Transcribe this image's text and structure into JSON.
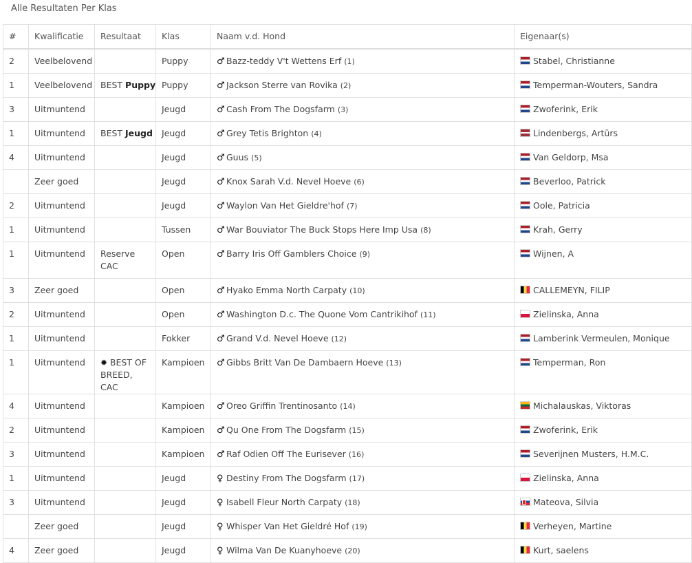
{
  "page": {
    "title": "Alle Resultaten Per Klas"
  },
  "columns": [
    "#",
    "Kwalificatie",
    "Resultaat",
    "Klas",
    "Naam v.d. Hond",
    "Eigenaar(s)"
  ],
  "rows": [
    {
      "rank": "2",
      "qual": "Veelbelovend",
      "res_prefix": "",
      "res_bold": "",
      "res_lines": [],
      "klas": "Puppy",
      "sex": "♂",
      "dog": "Bazz-teddy V't Wettens Erf",
      "catno": "(1)",
      "flag": "nl",
      "owner": "Stabel, Christianne"
    },
    {
      "rank": "1",
      "qual": "Veelbelovend",
      "res_prefix": "BEST",
      "res_bold": "Puppy",
      "res_lines": [],
      "klas": "Puppy",
      "sex": "♂",
      "dog": "Jackson Sterre van Rovika",
      "catno": "(2)",
      "flag": "nl",
      "owner": "Temperman-Wouters, Sandra"
    },
    {
      "rank": "3",
      "qual": "Uitmuntend",
      "res_prefix": "",
      "res_bold": "",
      "res_lines": [],
      "klas": "Jeugd",
      "sex": "♂",
      "dog": "Cash From The Dogsfarm",
      "catno": "(3)",
      "flag": "nl",
      "owner": "Zwoferink, Erik"
    },
    {
      "rank": "1",
      "qual": "Uitmuntend",
      "res_prefix": "BEST",
      "res_bold": "Jeugd",
      "res_lines": [],
      "klas": "Jeugd",
      "sex": "♂",
      "dog": "Grey Tetis Brighton",
      "catno": "(4)",
      "flag": "lv",
      "owner": "Lindenbergs, Artūrs"
    },
    {
      "rank": "4",
      "qual": "Uitmuntend",
      "res_prefix": "",
      "res_bold": "",
      "res_lines": [],
      "klas": "Jeugd",
      "sex": "♂",
      "dog": "Guus",
      "catno": "(5)",
      "flag": "nl",
      "owner": "Van Geldorp, Msa"
    },
    {
      "rank": "",
      "qual": "Zeer goed",
      "res_prefix": "",
      "res_bold": "",
      "res_lines": [],
      "klas": "Jeugd",
      "sex": "♂",
      "dog": "Knox Sarah V.d. Nevel Hoeve",
      "catno": "(6)",
      "flag": "nl",
      "owner": "Beverloo, Patrick"
    },
    {
      "rank": "2",
      "qual": "Uitmuntend",
      "res_prefix": "",
      "res_bold": "",
      "res_lines": [],
      "klas": "Jeugd",
      "sex": "♂",
      "dog": "Waylon Van Het Gieldre'hof",
      "catno": "(7)",
      "flag": "nl",
      "owner": "Oole, Patricia"
    },
    {
      "rank": "1",
      "qual": "Uitmuntend",
      "res_prefix": "",
      "res_bold": "",
      "res_lines": [],
      "klas": "Tussen",
      "sex": "♂",
      "dog": "War Bouviator The Buck Stops Here Imp Usa",
      "catno": "(8)",
      "flag": "nl",
      "owner": "Krah, Gerry"
    },
    {
      "rank": "1",
      "qual": "Uitmuntend",
      "res_prefix": "",
      "res_bold": "",
      "res_lines": [
        "Reserve",
        "CAC"
      ],
      "klas": "Open",
      "sex": "♂",
      "dog": "Barry Iris Off Gamblers Choice",
      "catno": "(9)",
      "flag": "nl",
      "owner": "Wijnen, A"
    },
    {
      "rank": "3",
      "qual": "Zeer goed",
      "res_prefix": "",
      "res_bold": "",
      "res_lines": [],
      "klas": "Open",
      "sex": "♂",
      "dog": "Hyako Emma North Carpaty",
      "catno": "(10)",
      "flag": "be",
      "owner": "CALLEMEYN, FILIP"
    },
    {
      "rank": "2",
      "qual": "Uitmuntend",
      "res_prefix": "",
      "res_bold": "",
      "res_lines": [],
      "klas": "Open",
      "sex": "♂",
      "dog": "Washington D.c. The Quone Vom Cantrikihof",
      "catno": "(11)",
      "flag": "pl",
      "owner": "Zielinska, Anna"
    },
    {
      "rank": "1",
      "qual": "Uitmuntend",
      "res_prefix": "",
      "res_bold": "",
      "res_lines": [],
      "klas": "Fokker",
      "sex": "♂",
      "dog": "Grand V.d. Nevel Hoeve",
      "catno": "(12)",
      "flag": "nl",
      "owner": "Lamberink Vermeulen, Monique"
    },
    {
      "rank": "1",
      "qual": "Uitmuntend",
      "res_prefix": "",
      "res_bold": "",
      "res_lines": [
        "BEST OF",
        "BREED, CAC"
      ],
      "res_star": true,
      "klas": "Kampioen",
      "sex": "♂",
      "dog": "Gibbs Britt Van De Dambaern Hoeve",
      "catno": "(13)",
      "flag": "nl",
      "owner": "Temperman, Ron"
    },
    {
      "rank": "4",
      "qual": "Uitmuntend",
      "res_prefix": "",
      "res_bold": "",
      "res_lines": [],
      "klas": "Kampioen",
      "sex": "♂",
      "dog": "Oreo Griffin Trentinosanto",
      "catno": "(14)",
      "flag": "lt",
      "owner": "Michalauskas, Viktoras"
    },
    {
      "rank": "2",
      "qual": "Uitmuntend",
      "res_prefix": "",
      "res_bold": "",
      "res_lines": [],
      "klas": "Kampioen",
      "sex": "♂",
      "dog": "Qu One From The Dogsfarm",
      "catno": "(15)",
      "flag": "nl",
      "owner": "Zwoferink, Erik"
    },
    {
      "rank": "3",
      "qual": "Uitmuntend",
      "res_prefix": "",
      "res_bold": "",
      "res_lines": [],
      "klas": "Kampioen",
      "sex": "♂",
      "dog": "Raf Odien Off The Eurisever",
      "catno": "(16)",
      "flag": "nl",
      "owner": "Severijnen Musters, H.M.C."
    },
    {
      "rank": "1",
      "qual": "Uitmuntend",
      "res_prefix": "",
      "res_bold": "",
      "res_lines": [],
      "klas": "Jeugd",
      "sex": "♀",
      "dog": "Destiny From The Dogsfarm",
      "catno": "(17)",
      "flag": "pl",
      "owner": "Zielinska, Anna"
    },
    {
      "rank": "3",
      "qual": "Uitmuntend",
      "res_prefix": "",
      "res_bold": "",
      "res_lines": [],
      "klas": "Jeugd",
      "sex": "♀",
      "dog": "Isabell Fleur North Carpaty",
      "catno": "(18)",
      "flag": "sk",
      "owner": "Mateova, Silvia"
    },
    {
      "rank": "",
      "qual": "Zeer goed",
      "res_prefix": "",
      "res_bold": "",
      "res_lines": [],
      "klas": "Jeugd",
      "sex": "♀",
      "dog": "Whisper Van Het Gieldré Hof",
      "catno": "(19)",
      "flag": "be",
      "owner": "Verheyen, Martine"
    },
    {
      "rank": "4",
      "qual": "Zeer goed",
      "res_prefix": "",
      "res_bold": "",
      "res_lines": [],
      "klas": "Jeugd",
      "sex": "♀",
      "dog": "Wilma Van De Kuanyhoeve",
      "catno": "(20)",
      "flag": "be",
      "owner": "Kurt, saelens"
    }
  ]
}
